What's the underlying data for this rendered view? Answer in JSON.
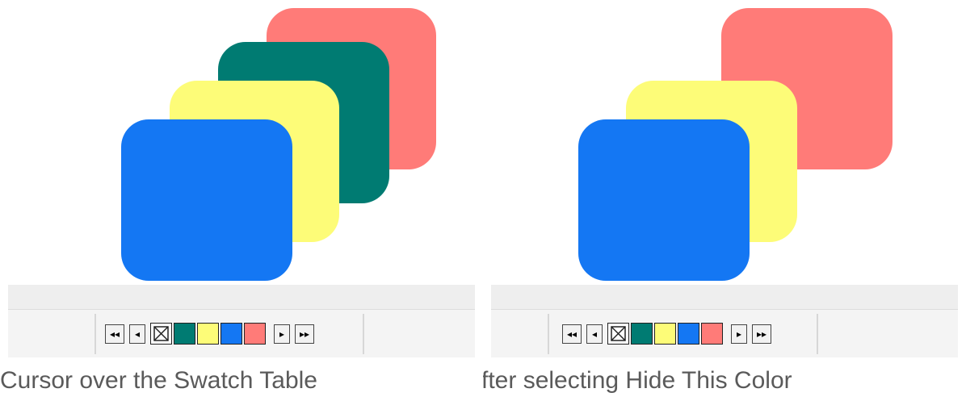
{
  "panels": [
    {
      "caption": "Cursor over the Swatch Table",
      "shapes": [
        {
          "name": "red",
          "color": "#ff7b78"
        },
        {
          "name": "teal",
          "color": "#007b72"
        },
        {
          "name": "yellow",
          "color": "#fdfc78"
        },
        {
          "name": "blue",
          "color": "#1477f3"
        }
      ],
      "swatches": [
        "none",
        "#007b72",
        "#fdfc78",
        "#1477f3",
        "#ff7b78"
      ]
    },
    {
      "caption": "After selecting Hide This Color",
      "shapes": [
        {
          "name": "red",
          "color": "#ff7b78"
        },
        {
          "name": "yellow",
          "color": "#fdfc78"
        },
        {
          "name": "blue",
          "color": "#1477f3"
        }
      ],
      "swatches": [
        "none",
        "#007b72",
        "#fdfc78",
        "#1477f3",
        "#ff7b78"
      ]
    }
  ],
  "nav_icons": {
    "first": "first-page-icon",
    "prev": "previous-icon",
    "next": "next-icon",
    "last": "last-page-icon"
  }
}
